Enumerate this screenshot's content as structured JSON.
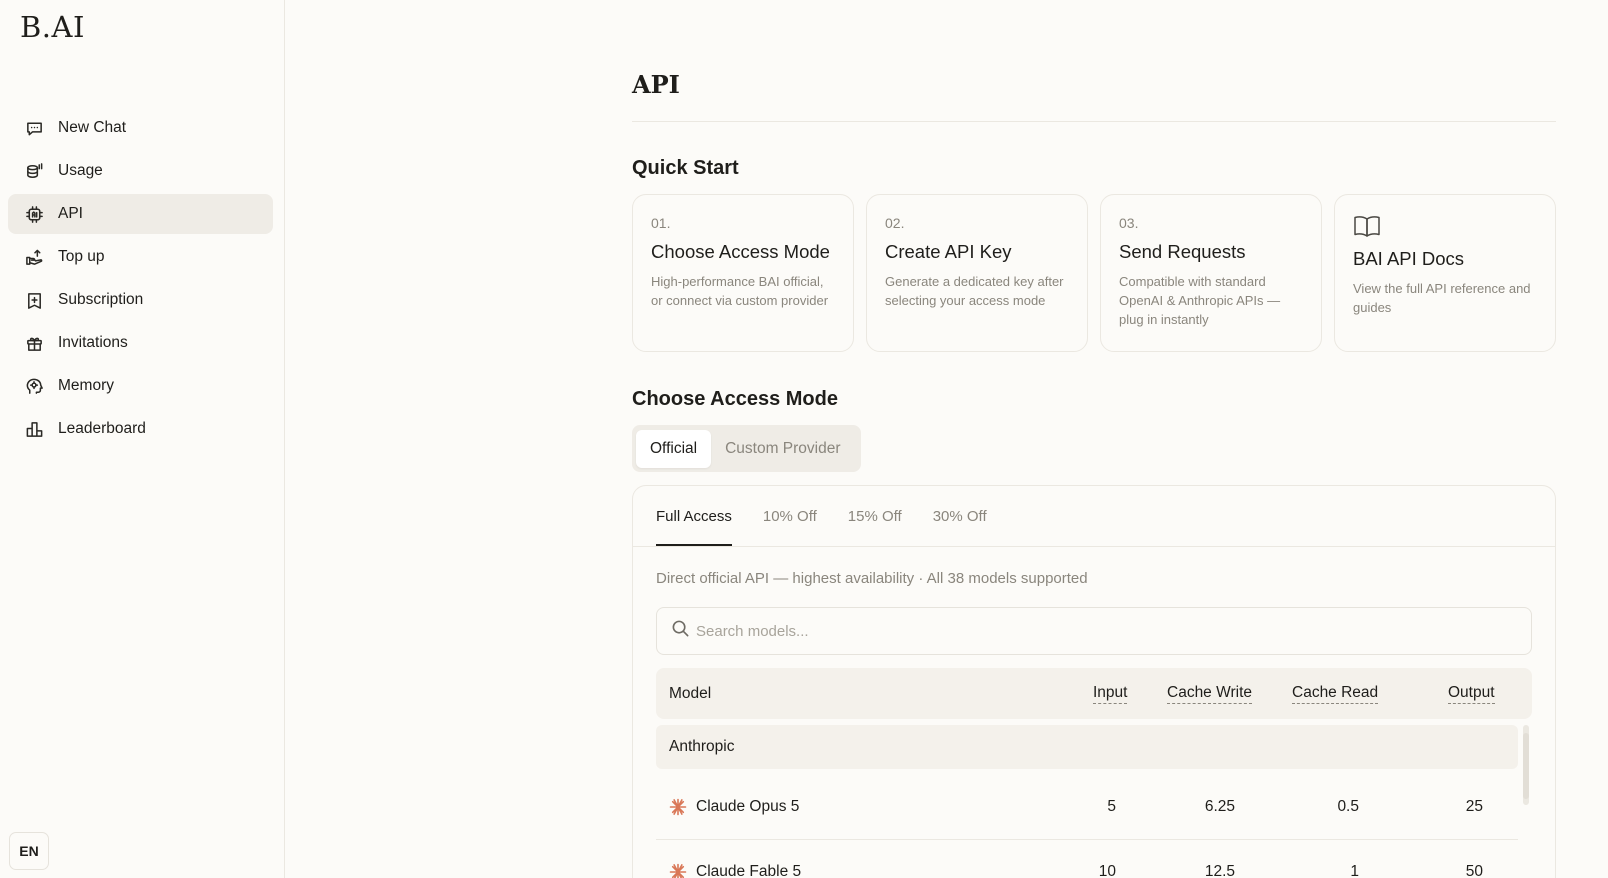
{
  "app": {
    "logo": "B.AI",
    "language": "EN"
  },
  "sidebar": {
    "items": [
      {
        "label": "New Chat",
        "icon": "chat-icon"
      },
      {
        "label": "Usage",
        "icon": "usage-icon"
      },
      {
        "label": "API",
        "icon": "api-chip-icon",
        "active": true
      },
      {
        "label": "Top up",
        "icon": "top-up-icon"
      },
      {
        "label": "Subscription",
        "icon": "subscription-icon"
      },
      {
        "label": "Invitations",
        "icon": "gift-icon"
      },
      {
        "label": "Memory",
        "icon": "memory-icon"
      },
      {
        "label": "Leaderboard",
        "icon": "leaderboard-icon"
      }
    ]
  },
  "main": {
    "title": "API",
    "quick_start": {
      "heading": "Quick Start",
      "cards": [
        {
          "num": "01.",
          "title": "Choose Access Mode",
          "desc": "High-performance BAI official, or connect via custom provider"
        },
        {
          "num": "02.",
          "title": "Create API Key",
          "desc": "Generate a dedicated key after selecting your access mode"
        },
        {
          "num": "03.",
          "title": "Send Requests",
          "desc": "Compatible with standard OpenAI & Anthropic APIs — plug in instantly"
        },
        {
          "icon": "book-icon",
          "title": "BAI API Docs",
          "desc": "View the full API reference and guides"
        }
      ]
    },
    "access_mode": {
      "heading": "Choose Access Mode",
      "options": [
        "Official",
        "Custom Provider"
      ],
      "selected": "Official"
    },
    "tiers": {
      "tabs": [
        "Full Access",
        "10% Off",
        "15% Off",
        "30% Off"
      ],
      "selected": "Full Access",
      "description": "Direct official API — highest availability · All 38 models supported",
      "search_placeholder": "Search models..."
    },
    "table": {
      "columns": [
        "Model",
        "Input",
        "Cache Write",
        "Cache Read",
        "Output"
      ],
      "groups": [
        {
          "name": "Anthropic",
          "rows": [
            {
              "model": "Claude Opus 5",
              "input": "5",
              "cache_write": "6.25",
              "cache_read": "0.5",
              "output": "25"
            },
            {
              "model": "Claude Fable 5",
              "input": "10",
              "cache_write": "12.5",
              "cache_read": "1",
              "output": "50"
            }
          ]
        }
      ]
    }
  },
  "colors": {
    "background": "#fcfbf8",
    "active_nav": "#efece6",
    "muted_text": "#8a867d",
    "anthropic_accent": "#d97757"
  }
}
